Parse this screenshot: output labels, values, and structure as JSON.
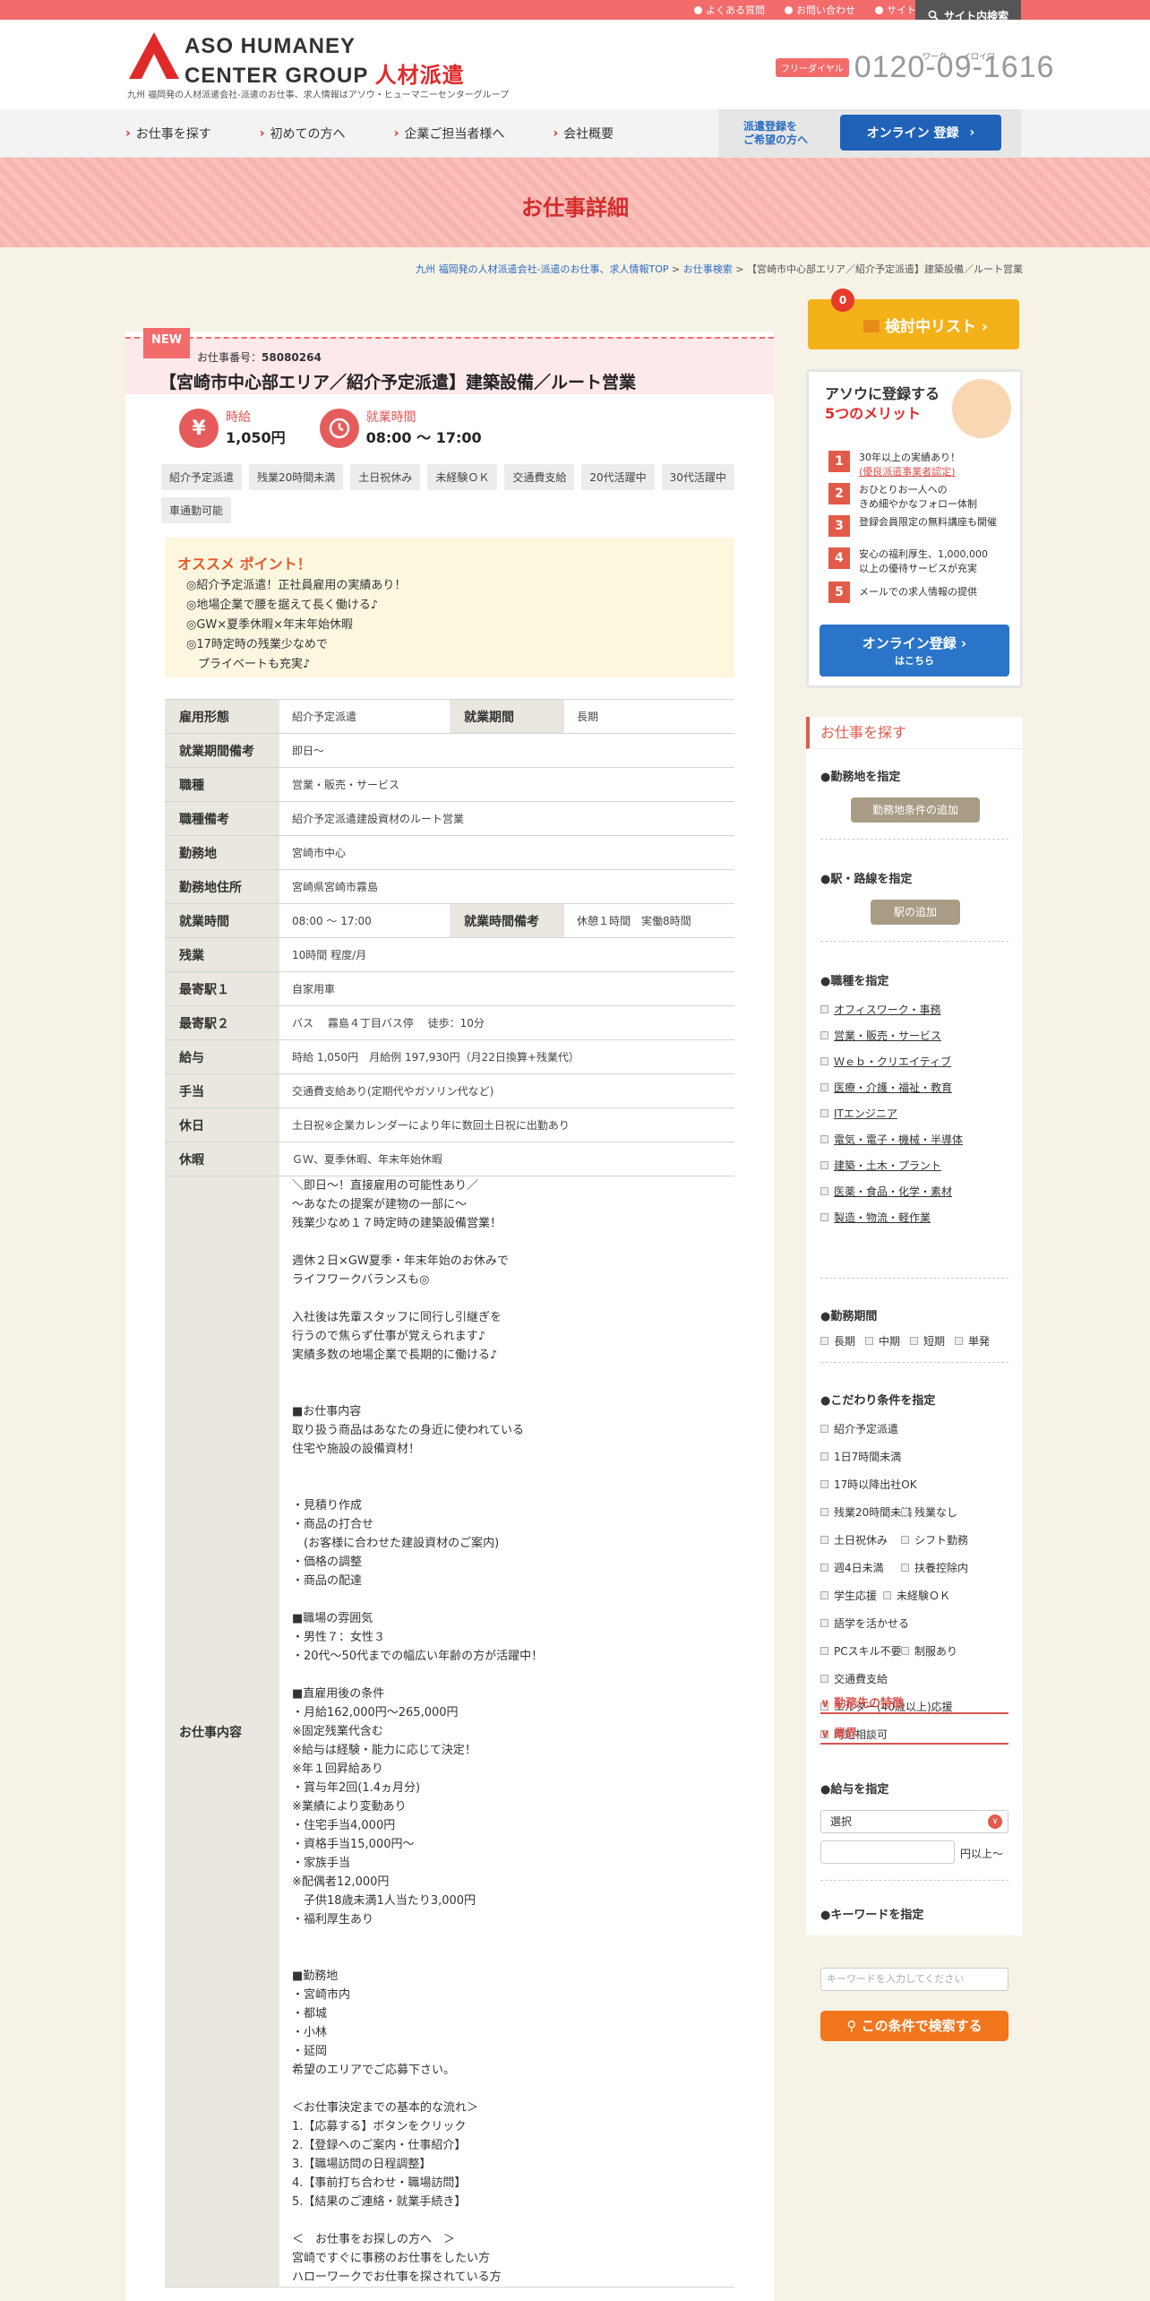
{
  "top_links": [
    "よくある質問",
    "お問い合わせ",
    "サイトマップ"
  ],
  "site_search": "サイト内検索",
  "logo": {
    "line1": "ASO HUMANEY",
    "line2": "CENTER GROUP",
    "brand": "人材派遣"
  },
  "tagline": "九州 福岡発の人材派遣会社-派遣のお仕事、求人情報はアソウ・ヒューマニーセンターグループ",
  "phone": {
    "label": "フリーダイヤル",
    "kana": "ワーク　　イロイロ",
    "number": "0120-09-1616"
  },
  "nav": [
    "お仕事を探す",
    "初めての方へ",
    "企業ご担当者様へ",
    "会社概要"
  ],
  "nav_register": {
    "label_line1": "派遣登録を",
    "label_line2": "ご希望の方へ",
    "button": "オンライン 登録"
  },
  "page_title": "お仕事詳細",
  "breadcrumb": {
    "home": "九州 福岡発の人材派遣会社-派遣のお仕事、求人情報TOP",
    "search": "お仕事検索",
    "current": "【宮崎市中心部エリア／紹介予定派遣】建築設備／ルート営業"
  },
  "job": {
    "new": "NEW",
    "number_label": "お仕事番号：",
    "number": "58080264",
    "title": "【宮崎市中心部エリア／紹介予定派遣】建築設備／ルート営業",
    "wage_label": "時給",
    "wage_value": "1,050円",
    "hours_label": "就業時間",
    "hours_value": "08:00 ～ 17:00",
    "tags": [
      "紹介予定派遣",
      "残業20時間未満",
      "土日祝休み",
      "未経験ＯＫ",
      "交通費支給",
      "20代活躍中",
      "30代活躍中",
      "車通勤可能"
    ],
    "recommend_title": "オススメ ポイント！",
    "recommend_points": [
      "◎紹介予定派遣！正社員雇用の実績あり！",
      "◎地場企業で腰を据えて長く働ける♪",
      "◎GW×夏季休暇×年末年始休暇",
      "◎17時定時の残業少なめで",
      "　プライベートも充実♪"
    ]
  },
  "table": {
    "employment_label": "雇用形態",
    "employment": "紹介予定派遣",
    "period_label": "就業期間",
    "period": "長期",
    "period_note_label": "就業期間備考",
    "period_note": "即日〜",
    "job_type_label": "職種",
    "job_type": "営業・販売・サービス",
    "job_note_label": "職種備考",
    "job_note": "紹介予定派遣建設資材のルート営業",
    "location_label": "勤務地",
    "location": "宮崎市中心",
    "address_label": "勤務地住所",
    "address": "宮崎県宮崎市霧島",
    "time_label": "就業時間",
    "time": "08:00 ～ 17:00",
    "time_note_label": "就業時間備考",
    "time_note": "休憩１時間　実働8時間",
    "overtime_label": "残業",
    "overtime": "10時間 程度/月",
    "station1_label": "最寄駅１",
    "station1": "自家用車",
    "station2_label": "最寄駅２",
    "station2": "バス　 霧島４丁目バス停　 徒歩：10分",
    "salary_label": "給与",
    "salary": "時給 1,050円　月給例 197,930円（月22日換算+残業代）",
    "allowance_label": "手当",
    "allowance": "交通費支給あり(定期代やガソリン代など)",
    "holiday_label": "休日",
    "holiday": "土日祝※企業カレンダーにより年に数回土日祝に出勤あり",
    "vacation_label": "休暇",
    "vacation": "ＧＷ、夏季休暇、年末年始休暇",
    "content_label": "お仕事内容",
    "content_lines": [
      "＼即日〜！直接雇用の可能性あり／",
      "〜あなたの提案が建物の一部に〜",
      "残業少なめ１７時定時の建築設備営業！",
      "",
      "週休２日×GW夏季・年末年始のお休みで",
      "ライフワークバランスも◎",
      "",
      "入社後は先輩スタッフに同行し引継ぎを",
      "行うので焦らず仕事が覚えられます♪",
      "実績多数の地場企業で長期的に働ける♪",
      "",
      "",
      "■お仕事内容",
      "取り扱う商品はあなたの身近に使われている",
      "住宅や施設の設備資材！",
      "",
      "",
      "・見積り作成",
      "・商品の打合せ",
      "　(お客様に合わせた建設資材のご案内)",
      "・価格の調整",
      "・商品の配達",
      "",
      "■職場の雰囲気",
      "・男性７：女性３",
      "・20代〜50代までの幅広い年齢の方が活躍中！",
      "",
      "■直雇用後の条件",
      "・月給162,000円〜265,000円",
      "※固定残業代含む",
      "※給与は経験・能力に応じて決定！",
      "※年１回昇給あり",
      "・賞与年2回(1.4ヵ月分)",
      "※業績により変動あり",
      "・住宅手当4,000円",
      "・資格手当15,000円〜",
      "・家族手当",
      "※配偶者12,000円",
      "　子供18歳未満1人当たり3,000円",
      "・福利厚生あり",
      "",
      "",
      "■勤務地",
      "・宮崎市内",
      "・都城",
      "・小林",
      "・延岡",
      "希望のエリアでご応募下さい。",
      "",
      "＜お仕事決定までの基本的な流れ＞",
      "1.【応募する】ボタンをクリック",
      "2.【登録へのご案内・仕事紹介】",
      "3.【職場訪問の日程調整】",
      "4.【事前打ち合わせ・職場訪問】",
      "5.【結果のご連絡・就業手続き】",
      "",
      "＜　お仕事をお探しの方へ　＞",
      "宮崎ですぐに事務のお仕事をしたい方",
      "ハローワークでお仕事を探されている方"
    ]
  },
  "sidebar": {
    "kentou_count": "0",
    "kentou_label": "検討中リスト",
    "merit_title_1": "アソウに登録する",
    "merit_title_2": "5つのメリット",
    "merits": [
      {
        "n": "1",
        "t": "30年以上の実績あり！",
        "t2": "(優良派遣事業者認定)"
      },
      {
        "n": "2",
        "t": "おひとりお一人への",
        "t2": "きめ細やかなフォロー体制"
      },
      {
        "n": "3",
        "t": "登録会員限定の無料講座も開催",
        "t2": ""
      },
      {
        "n": "4",
        "t": "安心の福利厚生、1,000,000",
        "t2": "以上の優待サービスが充実"
      },
      {
        "n": "5",
        "t": "メールでの求人情報の提供",
        "t2": ""
      }
    ],
    "merit_button_1": "オンライン登録",
    "merit_button_2": "はこちら",
    "search_title": "お仕事を探す",
    "area_title": "●勤務地を指定",
    "area_button": "勤務地条件の追加",
    "station_title": "●駅・路線を指定",
    "station_button": "駅の追加",
    "jobtype_title": "●職種を指定",
    "jobtypes": [
      "オフィスワーク・事務",
      "営業・販売・サービス",
      "Ｗｅｂ・クリエイティブ",
      "医療・介護・福祉・教育",
      "ITエンジニア",
      "電気・電子・機械・半導体",
      "建築・土木・プラント",
      "医薬・食品・化学・素材",
      "製造・物流・軽作業"
    ],
    "period_title": "●勤務期間",
    "periods": [
      "長期",
      "中期",
      "短期",
      "単発"
    ],
    "kodawari_title": "●こだわり条件を指定",
    "kodawari": [
      "紹介予定派遣",
      "1日7時間未満",
      "17時以降出社OK",
      "残業20時間未満",
      "残業なし",
      "土日祝休み",
      "シフト勤務",
      "週4日未満",
      "扶養控除内",
      "学生応援",
      "未経験ＯＫ",
      "語学を活かせる",
      "PCスキル不要",
      "制服あり",
      "交通費支給",
      "エルダー(40歳以上)応援",
      "時短相談可"
    ],
    "feature_head": "勤務先の特徴",
    "industry_head": "業界",
    "salary_title": "●給与を指定",
    "salary_select": "選択",
    "salary_suffix": "円以上〜",
    "keyword_title": "●キーワードを指定",
    "keyword_placeholder": "キーワードを入力してください",
    "search_button": "この条件で検索する"
  }
}
